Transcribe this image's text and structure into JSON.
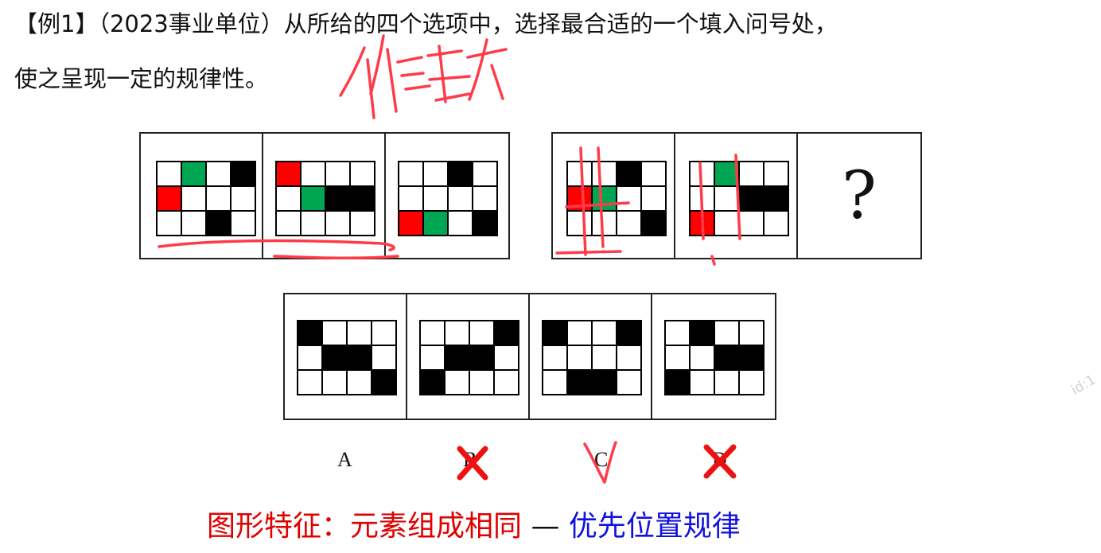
{
  "question": {
    "line1": "【例1】（2023事业单位）从所给的四个选项中，选择最合适的一个填入问号处，",
    "line2": "使之呈现一定的规律性。"
  },
  "figures": {
    "cols": 4,
    "rows": 3,
    "panels": [
      {
        "cells": [
          "w",
          "g",
          "w",
          "k",
          "r",
          "w",
          "w",
          "w",
          "w",
          "w",
          "k",
          "w"
        ]
      },
      {
        "cells": [
          "r",
          "w",
          "w",
          "w",
          "w",
          "g",
          "k",
          "k",
          "w",
          "w",
          "w",
          "w"
        ]
      },
      {
        "cells": [
          "w",
          "w",
          "k",
          "w",
          "w",
          "w",
          "w",
          "w",
          "r",
          "g",
          "w",
          "k"
        ]
      },
      {
        "cells": [
          "w",
          "w",
          "k",
          "w",
          "r",
          "g",
          "w",
          "w",
          "w",
          "w",
          "w",
          "k"
        ]
      },
      {
        "cells": [
          "w",
          "g",
          "w",
          "w",
          "w",
          "w",
          "k",
          "k",
          "r",
          "w",
          "w",
          "w"
        ]
      }
    ],
    "unknown_symbol": "?"
  },
  "options": [
    {
      "label": "A",
      "cells": [
        "k",
        "w",
        "w",
        "w",
        "w",
        "k",
        "k",
        "w",
        "w",
        "w",
        "w",
        "k"
      ],
      "mark": "none"
    },
    {
      "label": "B",
      "cells": [
        "w",
        "w",
        "w",
        "k",
        "w",
        "k",
        "k",
        "w",
        "k",
        "w",
        "w",
        "w"
      ],
      "mark": "cross"
    },
    {
      "label": "C",
      "cells": [
        "k",
        "w",
        "w",
        "k",
        "w",
        "w",
        "w",
        "w",
        "w",
        "k",
        "k",
        "w"
      ],
      "mark": "check"
    },
    {
      "label": "D",
      "cells": [
        "w",
        "k",
        "w",
        "w",
        "w",
        "w",
        "k",
        "k",
        "k",
        "w",
        "w",
        "w"
      ],
      "mark": "cross"
    }
  ],
  "feature": {
    "part1": "图形特征：元素组成相同",
    "dash": " — ",
    "part2": "优先位置规律"
  },
  "watermark": "id:1",
  "colors": {
    "red": "#ff0000",
    "green": "#00a651",
    "black": "#000000",
    "annotation": "#ff3b4a",
    "blue": "#1010e0"
  }
}
